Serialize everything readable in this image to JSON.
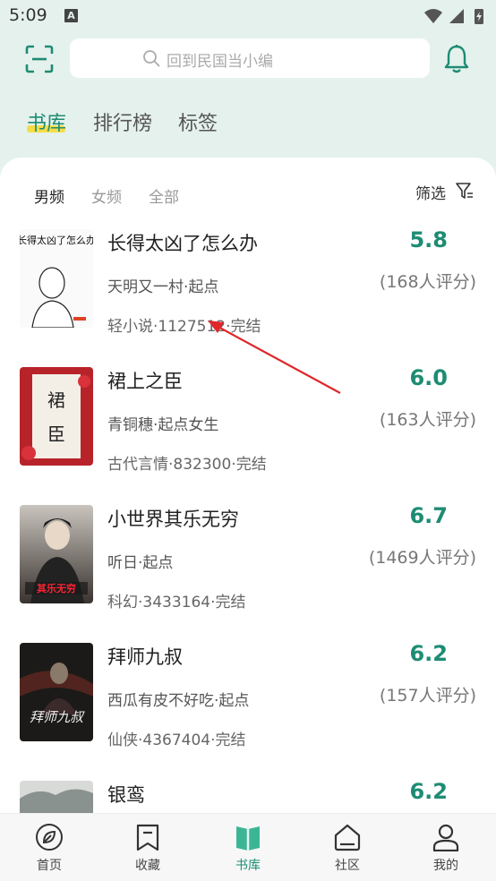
{
  "status_bar": {
    "time": "5:09",
    "notif_letter": "A"
  },
  "search": {
    "placeholder": "回到民国当小编"
  },
  "top_tabs": [
    {
      "label": "书库",
      "active": true
    },
    {
      "label": "排行榜",
      "active": false
    },
    {
      "label": "标签",
      "active": false
    }
  ],
  "gender_tabs": [
    {
      "label": "男频",
      "active": true
    },
    {
      "label": "女频",
      "active": false
    },
    {
      "label": "全部",
      "active": false
    }
  ],
  "filter": {
    "label": "筛选"
  },
  "books": [
    {
      "title": "长得太凶了怎么办",
      "author": "天明又一村·起点",
      "meta": "轻小说·1127512·完结",
      "score": "5.8",
      "raters": "(168人评分)",
      "cover_text": "长得太凶了怎么办"
    },
    {
      "title": "裙上之臣",
      "author": "青铜穗·起点女生",
      "meta": "古代言情·832300·完结",
      "score": "6.0",
      "raters": "(163人评分)",
      "cover_text": "裙上之臣"
    },
    {
      "title": "小世界其乐无穷",
      "author": "听日·起点",
      "meta": "科幻·3433164·完结",
      "score": "6.7",
      "raters": "(1469人评分)",
      "cover_text": "其乐无穷"
    },
    {
      "title": "拜师九叔",
      "author": "西瓜有皮不好吃·起点",
      "meta": "仙侠·4367404·完结",
      "score": "6.2",
      "raters": "(157人评分)",
      "cover_text": "拜师九叔"
    },
    {
      "title": "银鸾",
      "author": "",
      "meta": "",
      "score": "6.2",
      "raters": "",
      "cover_text": ""
    }
  ],
  "bottom_nav": [
    {
      "label": "首页",
      "icon": "home-leaf-icon",
      "active": false
    },
    {
      "label": "收藏",
      "icon": "bookmark-icon",
      "active": false
    },
    {
      "label": "书库",
      "icon": "book-library-icon",
      "active": true
    },
    {
      "label": "社区",
      "icon": "community-house-icon",
      "active": false
    },
    {
      "label": "我的",
      "icon": "person-icon",
      "active": false
    }
  ],
  "colors": {
    "accent": "#1d8c73",
    "tab_highlight": "#f4dd4a",
    "background": "#e5f1ec",
    "arrow": "#e0272a"
  }
}
